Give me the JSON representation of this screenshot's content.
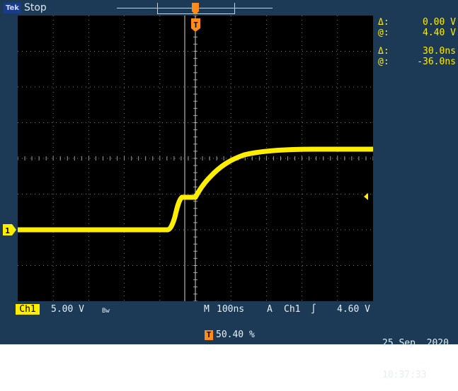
{
  "header": {
    "acq_badge": "Tek",
    "run_state": "Stop"
  },
  "trigger": {
    "top_marker": "T",
    "position_label": "50.40 %"
  },
  "readouts": {
    "delta_v_symbol": "Δ:",
    "delta_v": "0.00 V",
    "at_v_symbol": "@:",
    "at_v": "4.40 V",
    "delta_t_symbol": "Δ:",
    "delta_t": "30.0ns",
    "at_t_symbol": "@:",
    "at_t": "-36.0ns"
  },
  "channel": {
    "marker": "1",
    "tag": "Ch1",
    "scale": "5.00 V",
    "bw_symbol": "Bw"
  },
  "timebase": {
    "mode": "M",
    "scale": "100ns",
    "trigger_type": "A",
    "trigger_source": "Ch1",
    "trigger_slope": "∫",
    "trigger_level": "4.60 V"
  },
  "datetime": {
    "date": "25 Sep  2020",
    "time": "10:37:33"
  },
  "colors": {
    "trace": "#ffee00",
    "trigger_marker": "#ff8c1a",
    "cursor": "#d9d9c8",
    "grid": "#7a7a7a"
  }
}
